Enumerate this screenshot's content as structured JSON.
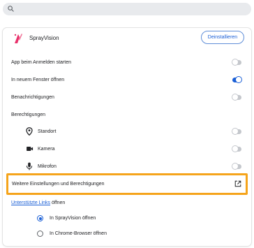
{
  "search": {
    "icon": "search-icon"
  },
  "app": {
    "name": "SprayVision",
    "uninstall_label": "Deinstallieren",
    "logo_color": "#e8316b"
  },
  "settings": {
    "start_on_login": {
      "label": "App beim Anmelden starten",
      "enabled": false
    },
    "open_new_window": {
      "label": "In neuem Fenster öffnen",
      "enabled": true
    },
    "notifications": {
      "label": "Benachrichtigungen",
      "enabled": false
    }
  },
  "permissions": {
    "heading": "Berechtigungen",
    "items": [
      {
        "label": "Standort",
        "icon": "location-pin-icon",
        "enabled": false
      },
      {
        "label": "Kamera",
        "icon": "camera-icon",
        "enabled": false
      },
      {
        "label": "Mikrofon",
        "icon": "microphone-icon",
        "enabled": false
      }
    ]
  },
  "more_settings": {
    "label": "Weitere Einstellungen und Berechtigungen",
    "icon": "open-external-icon"
  },
  "supported_links": {
    "link_text": "Unterstützte Links",
    "suffix": " öffnen",
    "options": [
      {
        "label": "In SprayVision öffnen",
        "selected": true
      },
      {
        "label": "In Chrome-Browser öffnen",
        "selected": false
      }
    ]
  },
  "colors": {
    "accent": "#1a5fd6",
    "highlight": "#f5a41b"
  }
}
